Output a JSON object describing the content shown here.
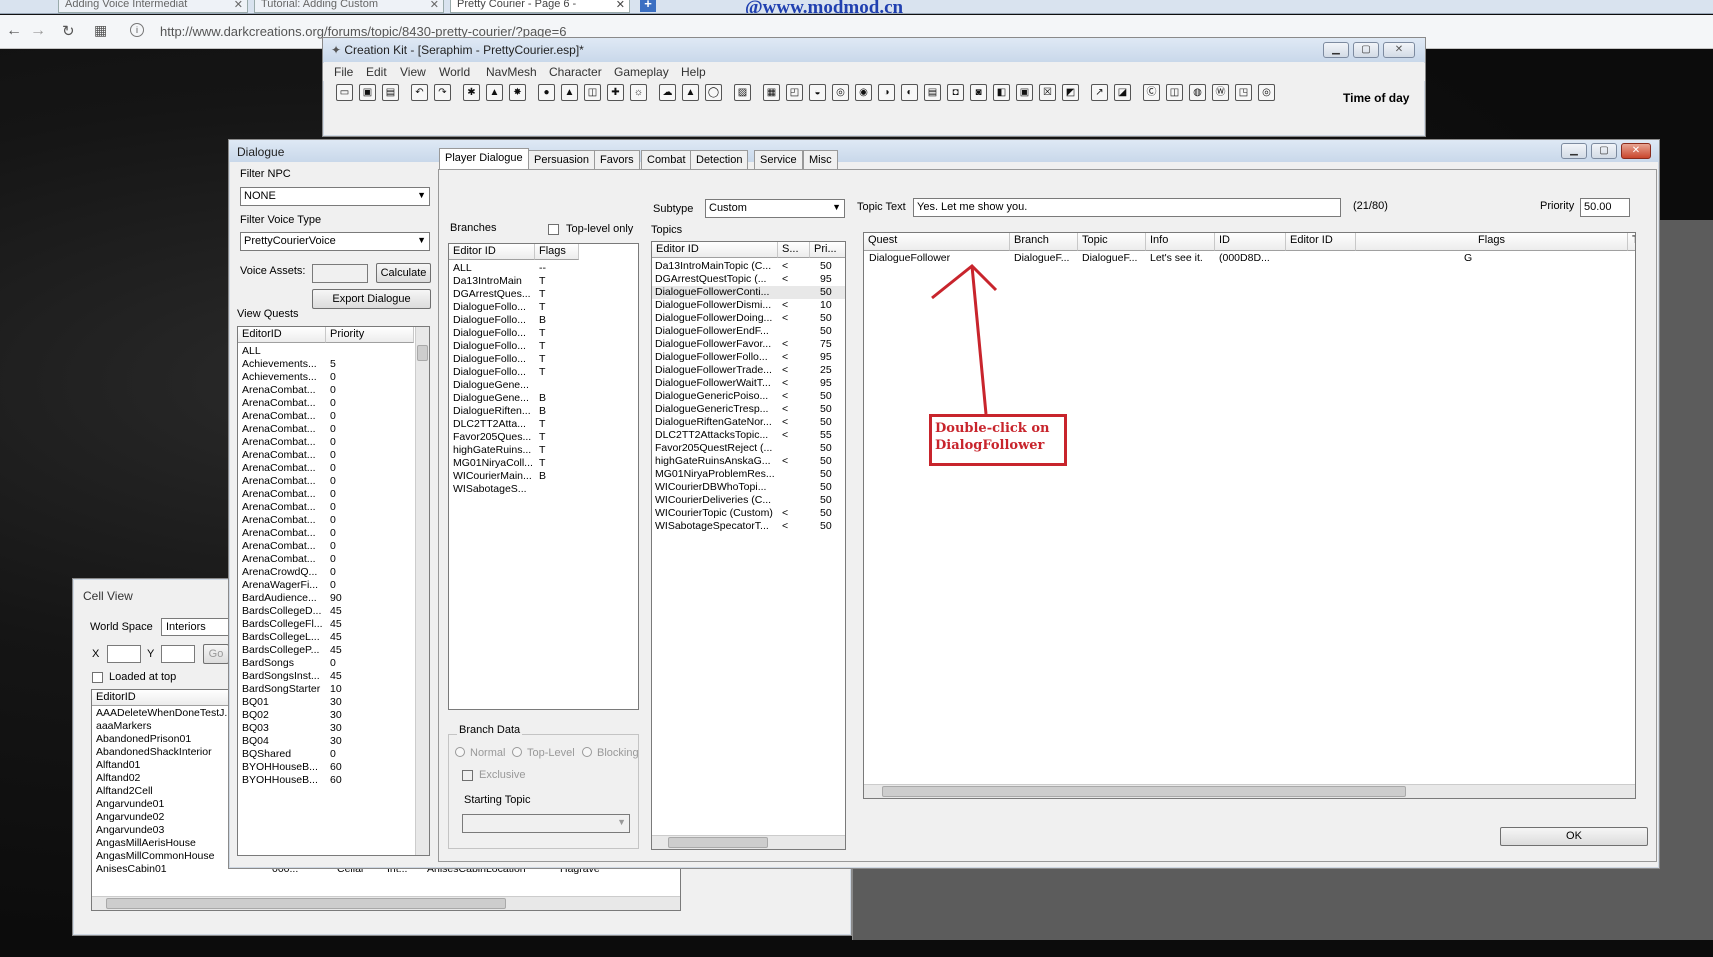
{
  "browser": {
    "tabs": [
      "Adding Voice Intermediat",
      "Tutorial: Adding Custom",
      "Pretty Courier - Page 6 -"
    ],
    "url": "http://www.darkcreations.org/forums/topic/8430-pretty-courier/?page=6",
    "watermark": "@www.modmod.cn"
  },
  "ck": {
    "title": "Creation Kit - [Seraphim - PrettyCourier.esp]*",
    "menu": [
      "File",
      "Edit",
      "View",
      "World",
      "NavMesh",
      "Character",
      "Gameplay",
      "Help"
    ],
    "time_label": "Time of day"
  },
  "dialogue": {
    "title": "Dialogue",
    "filter_npc_label": "Filter NPC",
    "filter_npc_value": "NONE",
    "filter_voice_label": "Filter Voice Type",
    "filter_voice_value": "PrettyCourierVoice",
    "voice_assets_label": "Voice Assets:",
    "calculate": "Calculate",
    "export": "Export Dialogue",
    "view_quests_label": "View Quests",
    "quest_cols": [
      "EditorID",
      "Priority"
    ],
    "quests": [
      [
        "ALL",
        ""
      ],
      [
        "Achievements...",
        "5"
      ],
      [
        "Achievements...",
        "0"
      ],
      [
        "ArenaCombat...",
        "0"
      ],
      [
        "ArenaCombat...",
        "0"
      ],
      [
        "ArenaCombat...",
        "0"
      ],
      [
        "ArenaCombat...",
        "0"
      ],
      [
        "ArenaCombat...",
        "0"
      ],
      [
        "ArenaCombat...",
        "0"
      ],
      [
        "ArenaCombat...",
        "0"
      ],
      [
        "ArenaCombat...",
        "0"
      ],
      [
        "ArenaCombat...",
        "0"
      ],
      [
        "ArenaCombat...",
        "0"
      ],
      [
        "ArenaCombat...",
        "0"
      ],
      [
        "ArenaCombat...",
        "0"
      ],
      [
        "ArenaCombat...",
        "0"
      ],
      [
        "ArenaCombat...",
        "0"
      ],
      [
        "ArenaCrowdQ...",
        "0"
      ],
      [
        "ArenaWagerFi...",
        "0"
      ],
      [
        "BardAudience...",
        "90"
      ],
      [
        "BardsCollegeD...",
        "45"
      ],
      [
        "BardsCollegeFl...",
        "45"
      ],
      [
        "BardsCollegeL...",
        "45"
      ],
      [
        "BardsCollegeP...",
        "45"
      ],
      [
        "BardSongs",
        "0"
      ],
      [
        "BardSongsInst...",
        "45"
      ],
      [
        "BardSongStarter",
        "10"
      ],
      [
        "BQ01",
        "30"
      ],
      [
        "BQ02",
        "30"
      ],
      [
        "BQ03",
        "30"
      ],
      [
        "BQ04",
        "30"
      ],
      [
        "BQShared",
        "0"
      ],
      [
        "BYOHHouseB...",
        "60"
      ],
      [
        "BYOHHouseB...",
        "60"
      ]
    ],
    "tabs": [
      "Player Dialogue",
      "Persuasion",
      "Favors",
      "Combat",
      "Detection",
      "Service",
      "Misc"
    ],
    "branches_label": "Branches",
    "toplevel_label": "Top-level only",
    "branch_cols": [
      "Editor ID",
      "Flags"
    ],
    "branches": [
      [
        "ALL",
        "--"
      ],
      [
        "Da13IntroMain",
        "T"
      ],
      [
        "DGArrestQues...",
        "T"
      ],
      [
        "DialogueFollo...",
        "T"
      ],
      [
        "DialogueFollo...",
        "B"
      ],
      [
        "DialogueFollo...",
        "T"
      ],
      [
        "DialogueFollo...",
        "T"
      ],
      [
        "DialogueFollo...",
        "T"
      ],
      [
        "DialogueFollo...",
        "T"
      ],
      [
        "DialogueGene...",
        ""
      ],
      [
        "DialogueGene...",
        "B"
      ],
      [
        "DialogueRiften...",
        "B"
      ],
      [
        "DLC2TT2Atta...",
        "T"
      ],
      [
        "Favor205Ques...",
        "T"
      ],
      [
        "highGateRuins...",
        "T"
      ],
      [
        "MG01NiryaColl...",
        "T"
      ],
      [
        "WICourierMain...",
        "B"
      ],
      [
        "WISabotageS...",
        ""
      ]
    ],
    "branch_data_label": "Branch Data",
    "normal": "Normal",
    "toplevel": "Top-Level",
    "blocking": "Blocking",
    "exclusive": "Exclusive",
    "starting_topic": "Starting Topic",
    "subtype_label": "Subtype",
    "subtype_value": "Custom",
    "topics_label": "Topics",
    "topic_cols": [
      "Editor ID",
      "S...",
      "Pri..."
    ],
    "topics": [
      [
        "Da13IntroMainTopic (C...",
        "<",
        "50"
      ],
      [
        "DGArrestQuestTopic (...",
        "<",
        "95"
      ],
      [
        "DialogueFollowerConti...",
        "",
        "50"
      ],
      [
        "DialogueFollowerDismi...",
        "<",
        "10"
      ],
      [
        "DialogueFollowerDoing...",
        "<",
        "50"
      ],
      [
        "DialogueFollowerEndF...",
        "",
        "50"
      ],
      [
        "DialogueFollowerFavor...",
        "<",
        "75"
      ],
      [
        "DialogueFollowerFollo...",
        "<",
        "95"
      ],
      [
        "DialogueFollowerTrade...",
        "<",
        "25"
      ],
      [
        "DialogueFollowerWaitT...",
        "<",
        "95"
      ],
      [
        "DialogueGenericPoiso...",
        "<",
        "50"
      ],
      [
        "DialogueGenericTresp...",
        "<",
        "50"
      ],
      [
        "DialogueRiftenGateNor...",
        "<",
        "50"
      ],
      [
        "DLC2TT2AttacksTopic...",
        "<",
        "55"
      ],
      [
        "Favor205QuestReject (...",
        "",
        "50"
      ],
      [
        "highGateRuinsAnskaG...",
        "<",
        "50"
      ],
      [
        "MG01NiryaProblemRes...",
        "",
        "50"
      ],
      [
        "WICourierDBWhoTopi...",
        "",
        "50"
      ],
      [
        "WICourierDeliveries (C...",
        "",
        "50"
      ],
      [
        "WICourierTopic (Custom)",
        "<",
        "50"
      ],
      [
        "WISabotageSpecatorT...",
        "<",
        "50"
      ]
    ],
    "topic_text_label": "Topic Text",
    "topic_text_value": "Yes. Let me show you.",
    "topic_count": "(21/80)",
    "priority_label": "Priority",
    "priority_value": "50.00",
    "info_cols": [
      "Quest",
      "Branch",
      "Topic",
      "Info",
      "ID",
      "Editor ID",
      "Flags",
      "T"
    ],
    "info_row": [
      "DialogueFollower",
      "DialogueF...",
      "DialogueF...",
      "Let's see it.",
      "(000D8D...",
      "",
      "G",
      ""
    ],
    "annotation": [
      "Double-click on",
      "DialogFollower"
    ],
    "ok": "OK"
  },
  "cellview": {
    "title": "Cell View",
    "worldspace_label": "World Space",
    "worldspace_value": "Interiors",
    "x_label": "X",
    "y_label": "Y",
    "go": "Go",
    "loaded_label": "Loaded at top",
    "col": "EditorID",
    "cells": [
      "AAADeleteWhenDoneTestJ...",
      "aaaMarkers",
      "AbandonedPrison01",
      "AbandonedShackInterior",
      "Alftand01",
      "Alftand02",
      "Alftand2Cell",
      "Angarvunde01",
      "Angarvunde02",
      "Angarvunde03",
      "AngasMillAerisHouse",
      "AngasMillCommonHouse",
      "AnisesCabin01"
    ],
    "last_row": [
      "000...",
      "Cellar",
      "Int...",
      "AnisesCabinLocation",
      "Hagrave"
    ]
  },
  "colors": {
    "annotation": "#c8242c",
    "titlebar": "#d4e1f0"
  }
}
